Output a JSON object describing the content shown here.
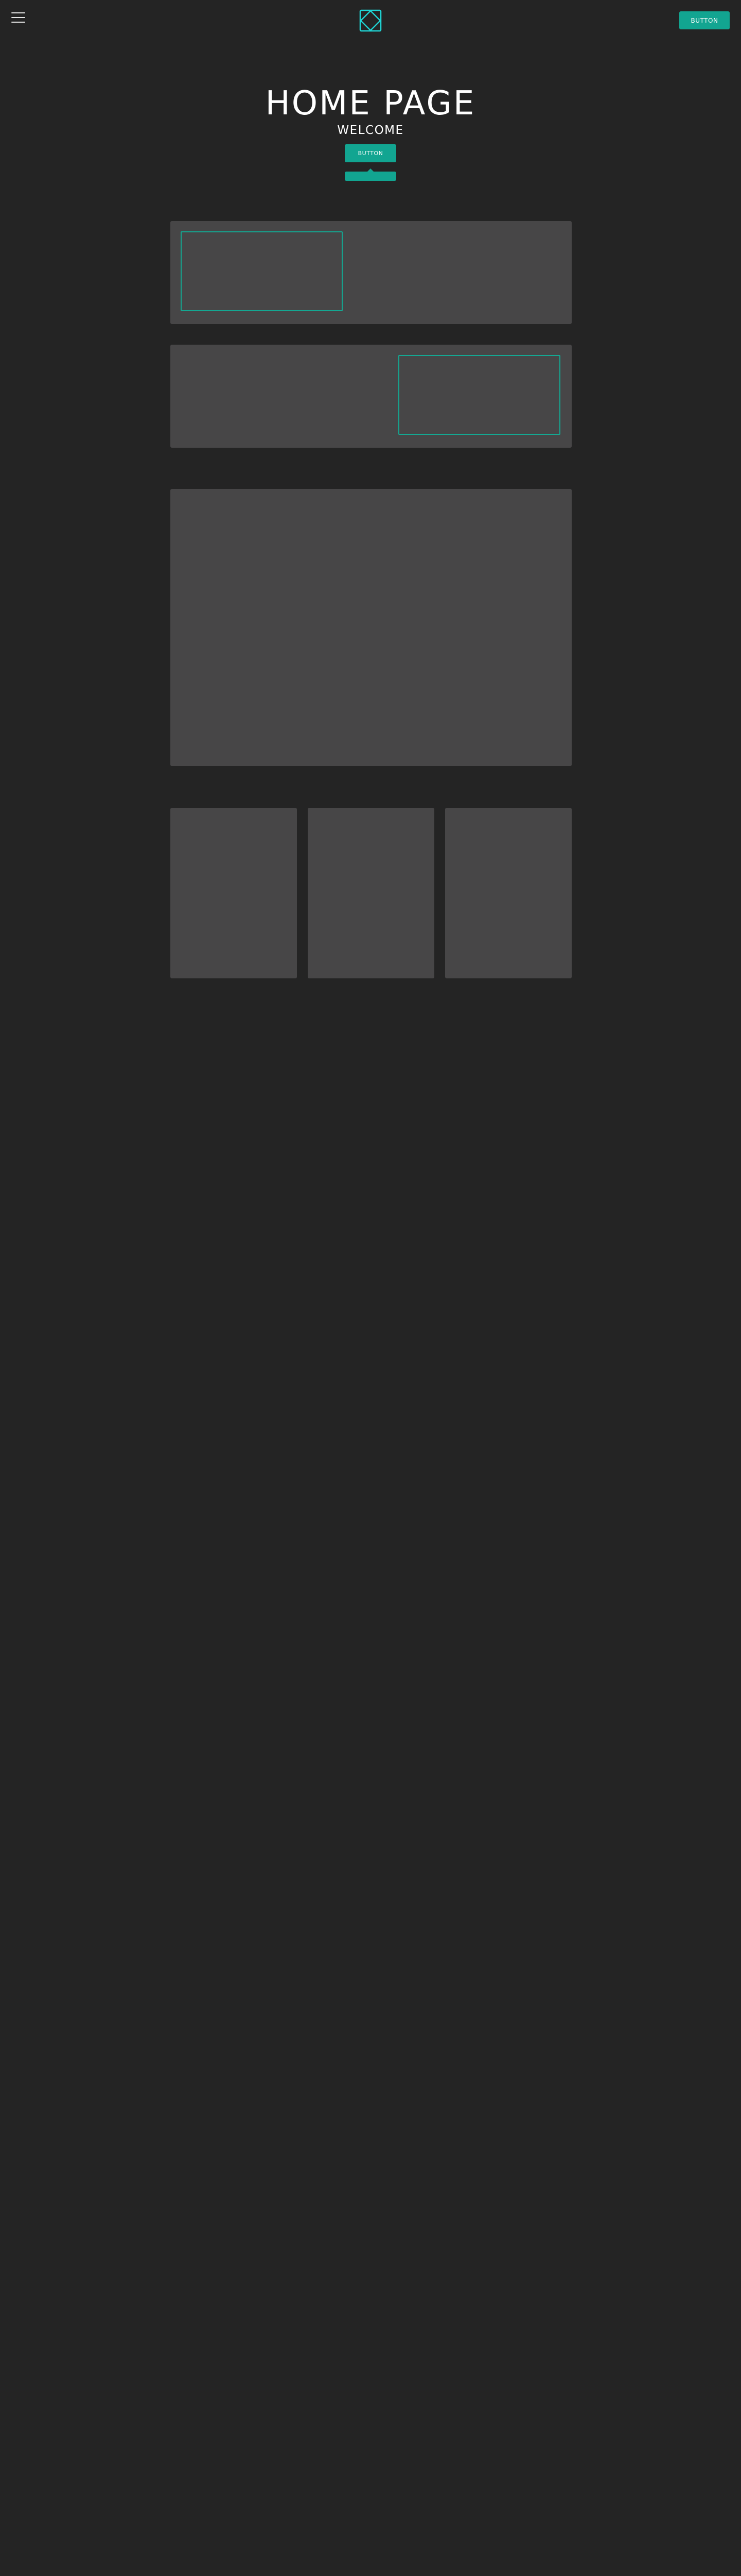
{
  "header": {
    "menu_icon": "hamburger-menu-icon",
    "logo_icon": "diamond-logo-icon",
    "button_label": "BUTTON"
  },
  "hero": {
    "title": "HOME PAGE",
    "subtitle": "WELCOME",
    "button_label": "BUTTON"
  },
  "colors": {
    "background": "#242424",
    "panel": "#474647",
    "accent": "#12a591",
    "logo_accent": "#1fd6d6",
    "text": "#ffffff"
  }
}
